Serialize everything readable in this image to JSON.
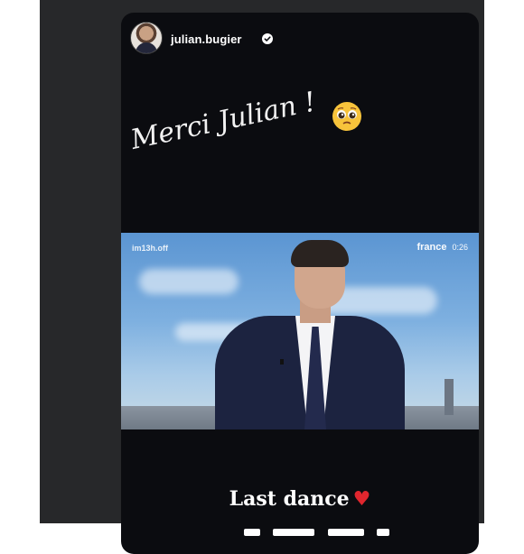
{
  "story": {
    "username": "julian.bugier",
    "caption": "Merci Julian !",
    "caption_emoji": "pleading-face-emoji",
    "bottom_text": "Last dance"
  },
  "video": {
    "watermark_left": "im13h.off",
    "brand": "france",
    "time": "0:26"
  },
  "icons": {
    "verified": "verified-badge-icon",
    "heart": "red-heart-icon"
  },
  "colors": {
    "background": "#27282a",
    "story_bg": "#0b0c10",
    "text": "#ffffff",
    "heart": "#e0262e"
  }
}
